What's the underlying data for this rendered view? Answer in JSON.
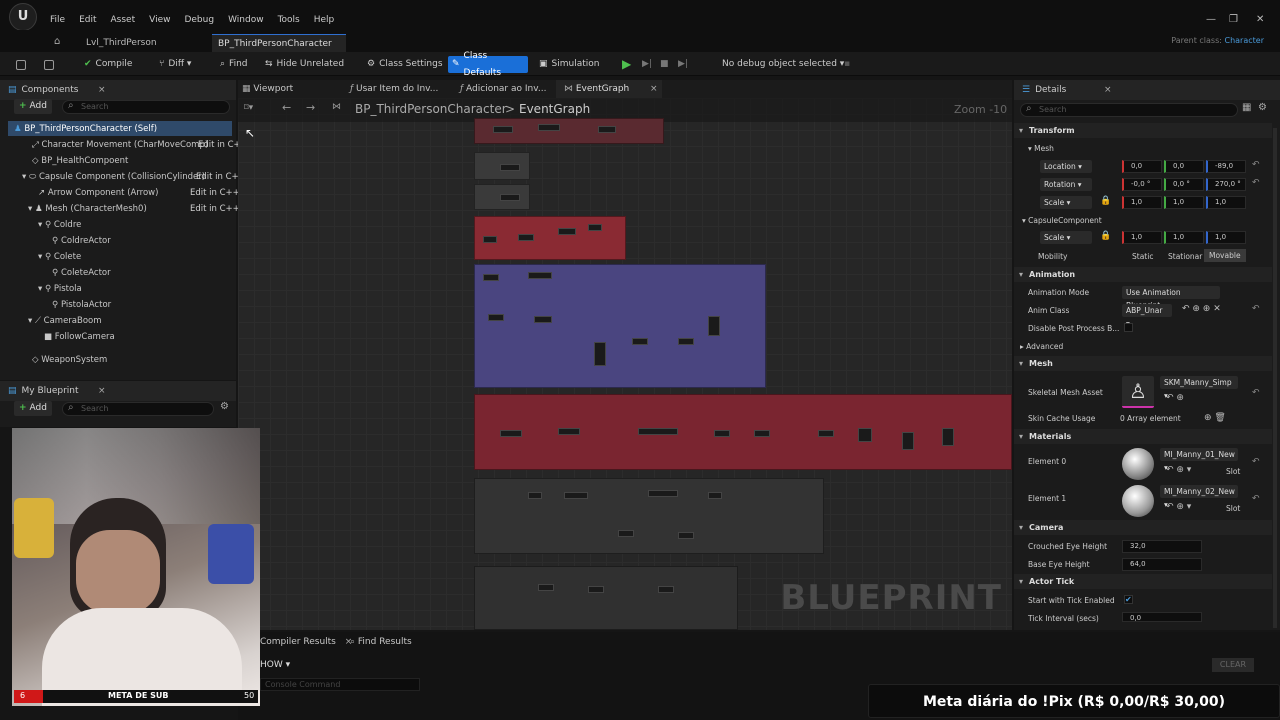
{
  "menubar": {
    "logo": "U",
    "items": [
      "File",
      "Edit",
      "Asset",
      "View",
      "Debug",
      "Window",
      "Tools",
      "Help"
    ]
  },
  "tabs": {
    "level": "Lvl_ThirdPerson",
    "blueprint": "BP_ThirdPersonCharacter",
    "close": "×",
    "parent_label": "Parent class:",
    "parent_value": "Character"
  },
  "toolbar": {
    "compile": "Compile",
    "diff": "Diff ▾",
    "find": "Find",
    "hide_unrelated": "Hide Unrelated",
    "class_settings": "Class Settings",
    "class_defaults": "Class Defaults",
    "simulation": "Simulation",
    "debug_object": "No debug object selected ▾"
  },
  "components": {
    "title": "Components",
    "add": "Add",
    "search_placeholder": "Search",
    "root": "BP_ThirdPersonCharacter (Self)",
    "items": [
      {
        "label": "Character Movement (CharMoveComp)",
        "edit": "Edit in C++"
      },
      {
        "label": "BP_HealthCompoent",
        "edit": ""
      },
      {
        "label": "Capsule Component (CollisionCylinder)",
        "edit": "Edit in C++"
      },
      {
        "label": "Arrow Component (Arrow)",
        "edit": "Edit in C++"
      },
      {
        "label": "Mesh (CharacterMesh0)",
        "edit": "Edit in C++"
      },
      {
        "label": "Coldre",
        "edit": ""
      },
      {
        "label": "ColdreActor",
        "edit": ""
      },
      {
        "label": "Colete",
        "edit": ""
      },
      {
        "label": "ColeteActor",
        "edit": ""
      },
      {
        "label": "Pistola",
        "edit": ""
      },
      {
        "label": "PistolaActor",
        "edit": ""
      },
      {
        "label": "CameraBoom",
        "edit": ""
      },
      {
        "label": "FollowCamera",
        "edit": ""
      },
      {
        "label": "WeaponSystem",
        "edit": ""
      }
    ]
  },
  "my_blueprint": {
    "title": "My Blueprint",
    "add": "Add",
    "search_placeholder": "Search"
  },
  "graph": {
    "tabs": [
      "Viewport",
      "Usar Item do Inv...",
      "Adicionar ao Inv...",
      "EventGraph"
    ],
    "breadcrumb_root": "BP_ThirdPersonCharacter",
    "breadcrumb_sep": ">",
    "breadcrumb_current": "EventGraph",
    "zoom": "Zoom -10",
    "watermark": "BLUEPRINT"
  },
  "details": {
    "title": "Details",
    "search_placeholder": "Search",
    "transform": "Transform",
    "mesh_sub": "Mesh",
    "location": "Location",
    "location_values": [
      "0,0",
      "0,0",
      "-89,0"
    ],
    "rotation": "Rotation",
    "rotation_values": [
      "-0,0 °",
      "0,0 °",
      "270,0 °"
    ],
    "scale": "Scale",
    "scale_values": [
      "1,0",
      "1,0",
      "1,0"
    ],
    "capsule_sub": "CapsuleComponent",
    "capsule_scale_values": [
      "1,0",
      "1,0",
      "1,0"
    ],
    "mobility": "Mobility",
    "mobility_options": [
      "Static",
      "Stationar",
      "Movable"
    ],
    "animation": "Animation",
    "animation_mode": "Animation Mode",
    "animation_mode_value": "Use Animation Blueprint ▾",
    "anim_class": "Anim Class",
    "anim_class_value": "ABP_Unar ▾",
    "disable_post": "Disable Post Process B...",
    "advanced": "Advanced",
    "mesh": "Mesh",
    "skeletal_mesh": "Skeletal Mesh Asset",
    "skeletal_mesh_value": "SKM_Manny_Simp ▾",
    "skin_cache": "Skin Cache Usage",
    "skin_cache_value": "0 Array element",
    "materials": "Materials",
    "element0": "Element 0",
    "element0_value": "MI_Manny_01_New ▾",
    "element1": "Element 1",
    "element1_value": "MI_Manny_02_New ▾",
    "slot": "Slot",
    "camera": "Camera",
    "crouched_eye": "Crouched Eye Height",
    "crouched_eye_value": "32,0",
    "base_eye": "Base Eye Height",
    "base_eye_value": "64,0",
    "actor_tick": "Actor Tick",
    "tick_enabled": "Start with Tick Enabled",
    "tick_interval": "Tick Interval (secs)",
    "tick_interval_value": "0,0"
  },
  "bottom": {
    "compiler_results": "Compiler Results",
    "find_results": "Find Results",
    "show": "HOW ▾",
    "console_placeholder": "Console Command",
    "clear": "CLEAR"
  },
  "overlay": {
    "sub_left": "6",
    "sub_label": "META DE SUB",
    "sub_right": "50",
    "sub_progress": 0.12,
    "pix": "Meta diária do !Pix (R$ 0,00/R$ 30,00)"
  },
  "colors": {
    "accent": "#1a6fd8",
    "selected_row": "#2f4a6a",
    "comment_red": "#8a2a33",
    "comment_blue": "#4a4580",
    "comment_gray": "#3a3a3a"
  }
}
